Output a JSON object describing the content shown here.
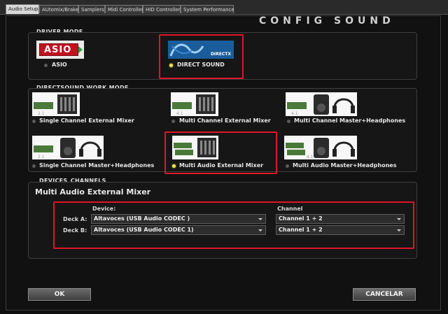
{
  "tabs": [
    {
      "label": "Audio Setup",
      "active": true
    },
    {
      "label": "AUtomix/Brake",
      "active": false
    },
    {
      "label": "Samplers",
      "active": false
    },
    {
      "label": "Midi Controller",
      "active": false
    },
    {
      "label": "HID Controller",
      "active": false
    },
    {
      "label": "System Performance",
      "active": false
    }
  ],
  "title": "CONFIG SOUND",
  "driver_mode": {
    "label": "DRIVER MODE",
    "asio_logo_text": "ASIO",
    "directx_logo_text": "DIRECTX",
    "options": [
      {
        "label": "ASIO",
        "selected": false
      },
      {
        "label": "DIRECT SOUND",
        "selected": true
      }
    ]
  },
  "work_mode": {
    "label": "DIRECTSOUND WORK MODE",
    "options": [
      {
        "label": "Single Channel External Mixer",
        "badge": "2.1",
        "selected": false
      },
      {
        "label": "Multi Channel External Mixer",
        "badge": "4.1",
        "selected": false
      },
      {
        "label": "Multi Channel Master+Headphones",
        "badge": "4.1",
        "selected": false
      },
      {
        "label": "Single Channel Master+Headphones",
        "badge": "2.1",
        "selected": false
      },
      {
        "label": "Multi Audio External Mixer",
        "badge": "",
        "selected": true
      },
      {
        "label": "Multi Audio Master+Headphones",
        "badge": "4.1",
        "selected": false
      }
    ]
  },
  "devices": {
    "label": "DEVICES_CHANNELS",
    "subtitle": "Multi Audio External Mixer",
    "device_header": "Device:",
    "channel_header": "Channel",
    "rows": [
      {
        "deck": "Deck A:",
        "device": "Altavoces (USB Audio CODEC )",
        "channel": "Channel 1 + 2"
      },
      {
        "deck": "Deck B:",
        "device": "Altavoces (USB Audio CODEC 1)",
        "channel": "Channel 1 + 2"
      }
    ]
  },
  "buttons": {
    "ok": "OK",
    "cancel": "CANCELAR"
  },
  "colors": {
    "highlight": "#e0152a",
    "radio_on": "#f5e34a",
    "asio_red": "#c1121f",
    "directx_blue": "#1a5d9a"
  }
}
